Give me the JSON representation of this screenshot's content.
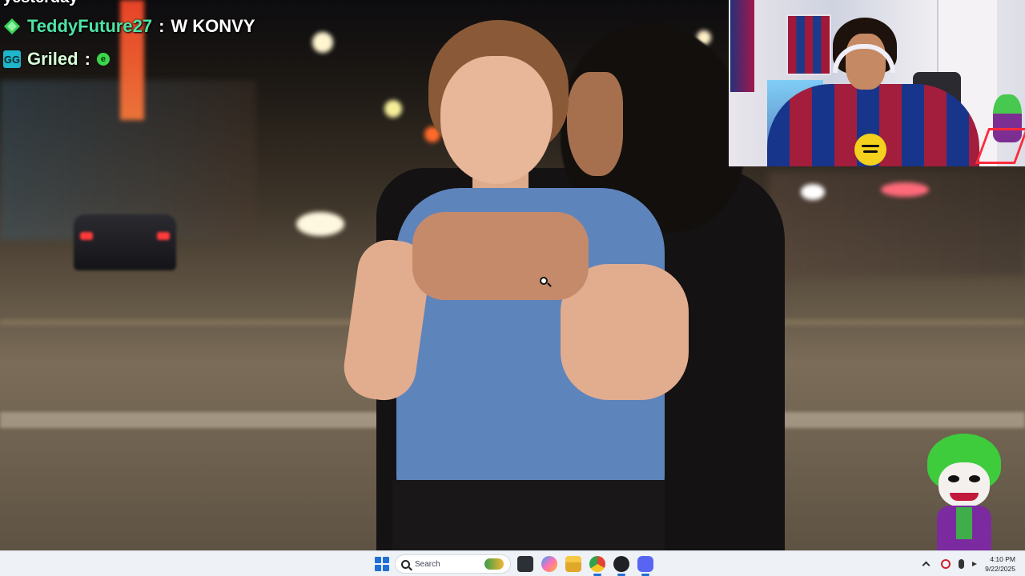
{
  "chat": {
    "cut_line": "yesterday",
    "messages": [
      {
        "badge": "gem",
        "user": "TeddyFuture27",
        "separator": ":",
        "text": "W KONVY"
      },
      {
        "badge": "GG",
        "user": "Griled",
        "separator": ":",
        "emote": "e"
      }
    ]
  },
  "taskbar": {
    "search_placeholder": "Search",
    "apps": [
      "terminal-icon",
      "copilot-icon",
      "file-explorer-icon",
      "chrome-icon",
      "obs-icon",
      "discord-icon"
    ],
    "clock_time": "4:10 PM",
    "clock_date": "9/22/2025"
  },
  "colors": {
    "chat_user_1": "#4fe3a5",
    "chat_user_2": "#d8ffd8",
    "taskbar_bg": "#eef1f6",
    "accent": "#1f6fd6"
  }
}
